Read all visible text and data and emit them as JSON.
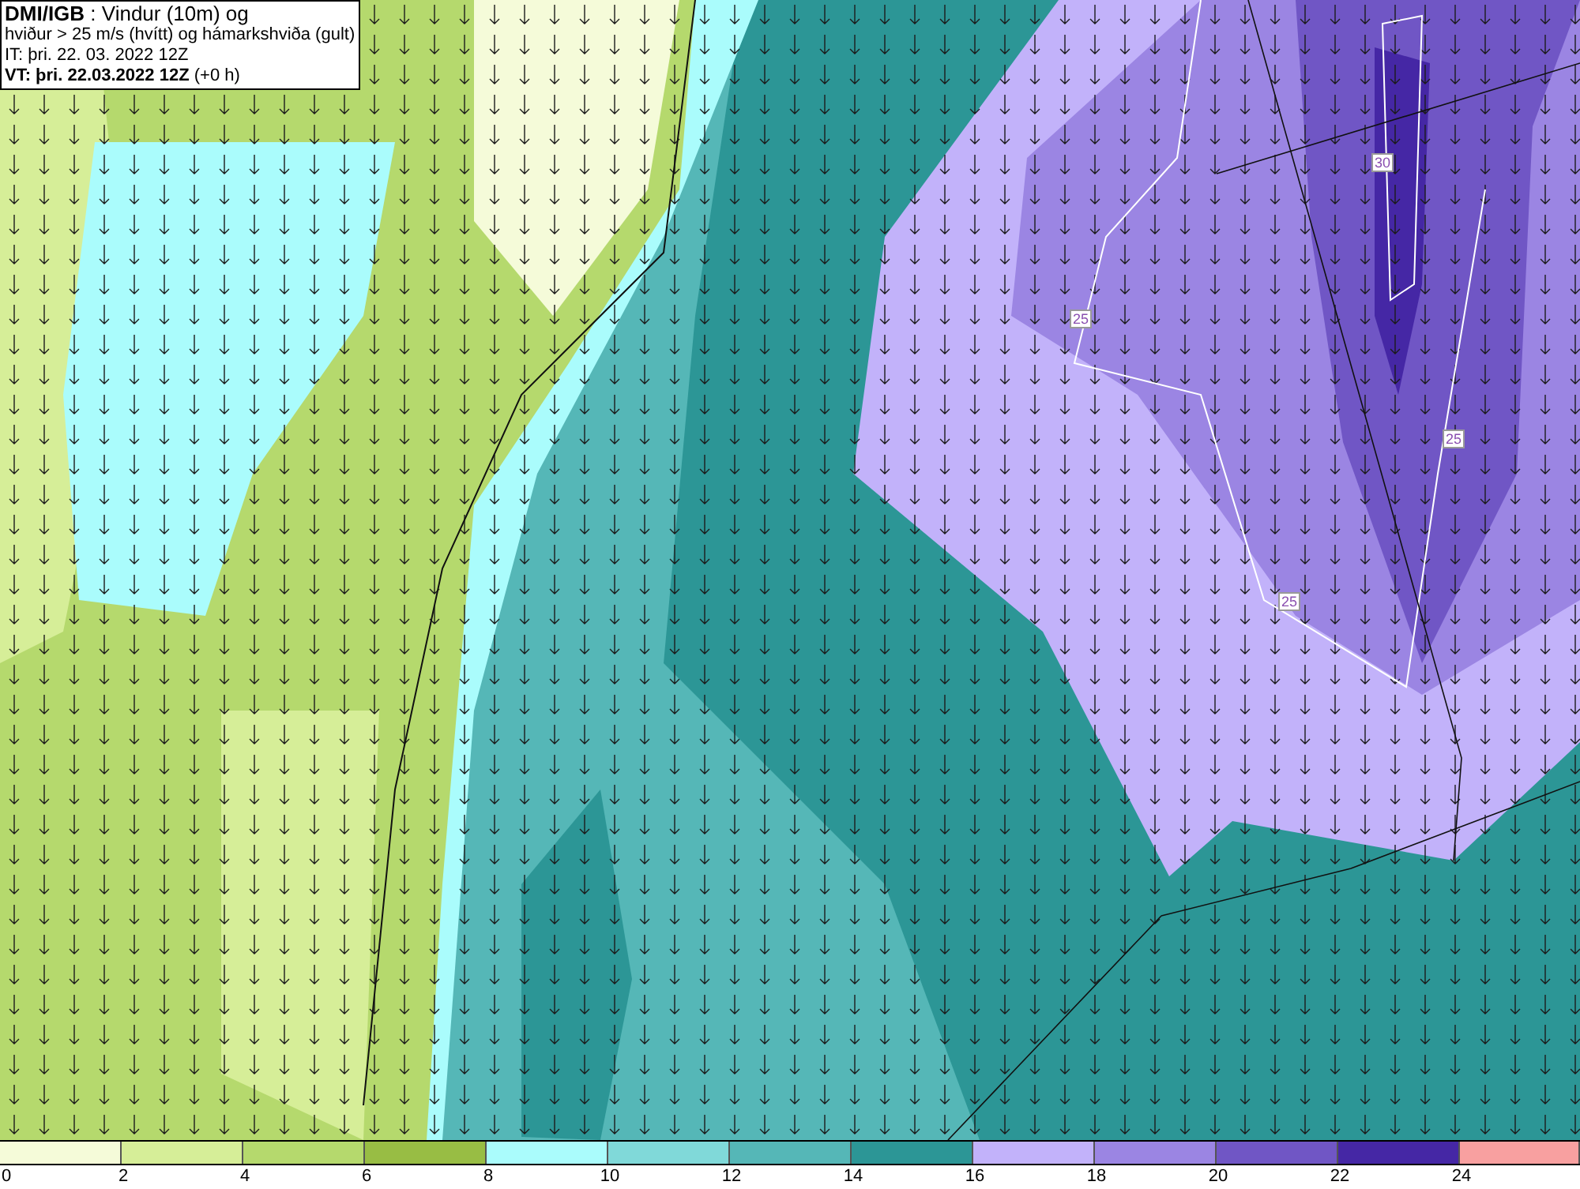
{
  "header": {
    "lines": [
      "**DMI/IGB** : Vindur (10m) og",
      "hviður > 25 m/s (hvítt) og hámarkshviða (gult)",
      "IT: þri. 22. 03. 2022 12Z",
      "**VT: þri. 22.03.2022 12Z** (+0 h)"
    ]
  },
  "map": {
    "contour_labels": [
      "30",
      "25",
      "25",
      "25"
    ]
  },
  "legend": {
    "segments": [
      {
        "color": "#f5fbd9"
      },
      {
        "color": "#d6ee98"
      },
      {
        "color": "#b5d96d"
      },
      {
        "color": "#98bd44"
      },
      {
        "color": "#aafcfc"
      },
      {
        "color": "#80d9d9"
      },
      {
        "color": "#55b7b7"
      },
      {
        "color": "#2c9696"
      },
      {
        "color": "#c2b2fa"
      },
      {
        "color": "#9b85e3"
      },
      {
        "color": "#7056c5"
      },
      {
        "color": "#4527a5"
      },
      {
        "color": "#f8a0a0"
      }
    ],
    "ticks": [
      "0",
      "2",
      "4",
      "6",
      "8",
      "10",
      "12",
      "14",
      "16",
      "18",
      "20",
      "22",
      "24"
    ]
  }
}
